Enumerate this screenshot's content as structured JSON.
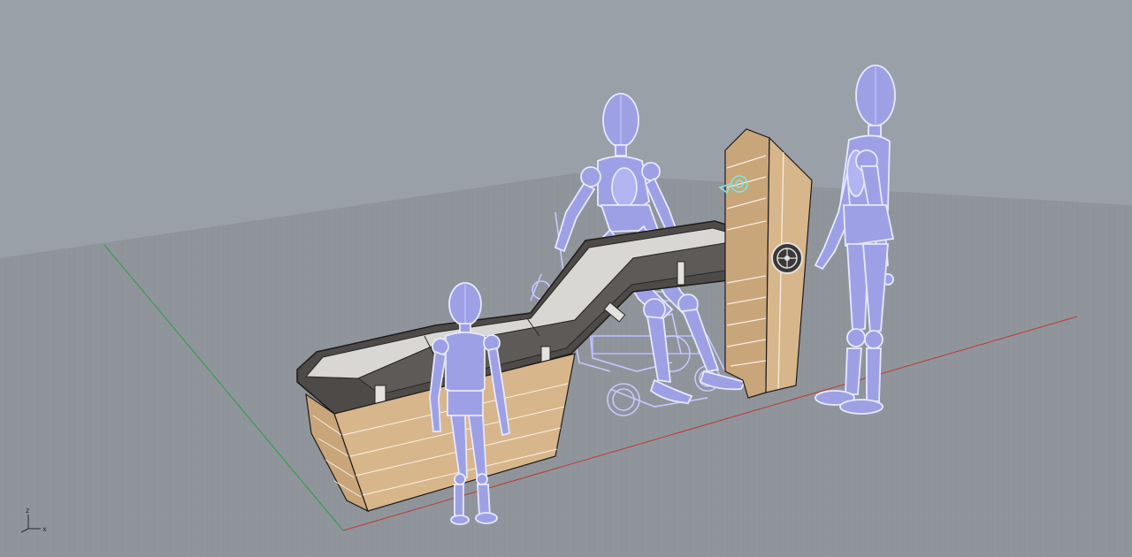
{
  "viewport": {
    "background_color": "#9aa0a8",
    "grid_color": "#8e949c",
    "grid_line_color": "#7f858d",
    "x_axis_color": "#c0392b",
    "y_axis_color": "#2e9e3e",
    "mannequin_fill": "#9ea0e6",
    "mannequin_edge": "#e6e8ff",
    "wood_color": "#d8b68b",
    "tray_color": "#4d4a47",
    "gizmo": {
      "z_label": "z",
      "x_label": "x"
    }
  }
}
